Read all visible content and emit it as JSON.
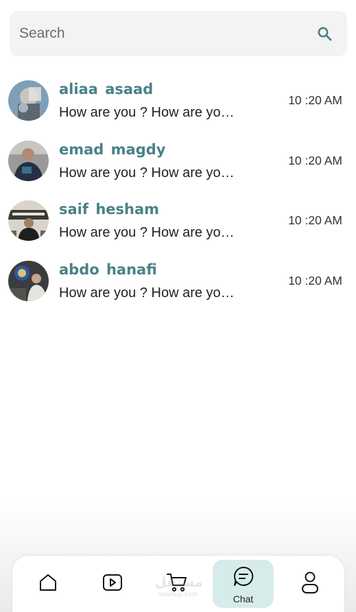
{
  "search": {
    "placeholder": "Search",
    "icon": "search-icon"
  },
  "accent_color": "#4a8189",
  "chats": [
    {
      "name": "aliaa  asaad",
      "preview": "How are you ? How are you ? How are you",
      "time": "10 :20 AM"
    },
    {
      "name": "emad  magdy",
      "preview": "How are you ? How are you ? How are you",
      "time": "10 :20 AM"
    },
    {
      "name": "saif  hesham",
      "preview": "How are you ? How are you ? How are you",
      "time": "10 :20 AM"
    },
    {
      "name": "abdo  hanafi",
      "preview": "How are you ? How are you ? How are you",
      "time": "10 :20 AM"
    }
  ],
  "nav": {
    "items": [
      {
        "icon": "home-icon"
      },
      {
        "icon": "video-icon"
      },
      {
        "icon": "cart-icon"
      },
      {
        "icon": "chat-icon",
        "label": "Chat",
        "active": true
      },
      {
        "icon": "profile-icon"
      }
    ],
    "active_bg": "#d6eceb"
  },
  "watermark": {
    "text": "مستقل",
    "sub": "mostaql.com"
  }
}
